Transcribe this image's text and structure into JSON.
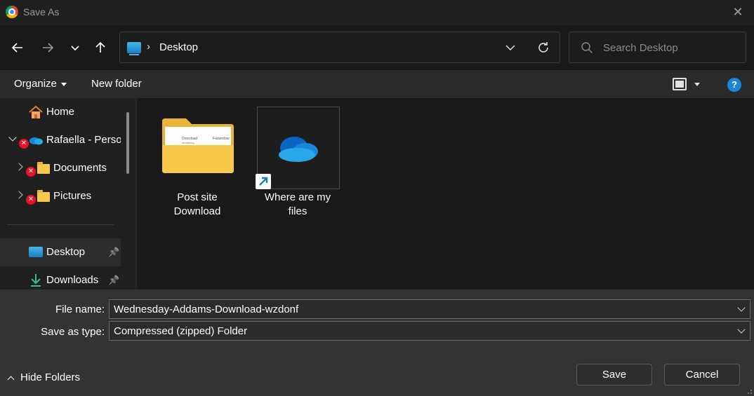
{
  "window": {
    "title": "Save As",
    "app_icon": "chrome-icon",
    "close_icon": "close-icon"
  },
  "nav": {
    "back_icon": "arrow-left-icon",
    "forward_icon": "arrow-right-icon",
    "recent_icon": "chevron-down-icon",
    "up_icon": "arrow-up-icon"
  },
  "address": {
    "separator": "›",
    "location": "Desktop",
    "icon": "desktop-icon"
  },
  "search": {
    "placeholder": "Search Desktop",
    "value": ""
  },
  "toolbar": {
    "organize_label": "Organize",
    "new_folder_label": "New folder",
    "help_label": "?"
  },
  "sidebar": {
    "items": [
      {
        "label": "Home",
        "icon": "home-icon"
      },
      {
        "label": "Rafaella - Persor",
        "icon": "onedrive-icon",
        "error": true
      },
      {
        "label": "Documents",
        "icon": "folder-icon",
        "error": true
      },
      {
        "label": "Pictures",
        "icon": "folder-icon",
        "error": true
      },
      {
        "label": "Desktop",
        "icon": "desktop-icon",
        "pinned": true
      },
      {
        "label": "Downloads",
        "icon": "download-icon",
        "pinned": true
      }
    ],
    "error_glyph": "✕",
    "pin_glyph": "📌"
  },
  "files": [
    {
      "label": "Post site Download",
      "icon": "folder-icon",
      "preview_lines": [
        "Download",
        "remaining",
        "Fasterdow"
      ]
    },
    {
      "label": "Where are my files",
      "icon": "onedrive-icon",
      "shortcut": true
    }
  ],
  "form": {
    "file_name_label": "File name:",
    "file_name_value": "Wednesday-Addams-Download-wzdonf",
    "save_type_label": "Save as type:",
    "save_type_value": "Compressed (zipped) Folder"
  },
  "footer": {
    "hide_folders_label": "Hide Folders",
    "save_label": "Save",
    "cancel_label": "Cancel"
  },
  "colors": {
    "accent": "#1a86d9",
    "folder": "#f8c94b",
    "error": "#e81123",
    "background": "#202020"
  }
}
